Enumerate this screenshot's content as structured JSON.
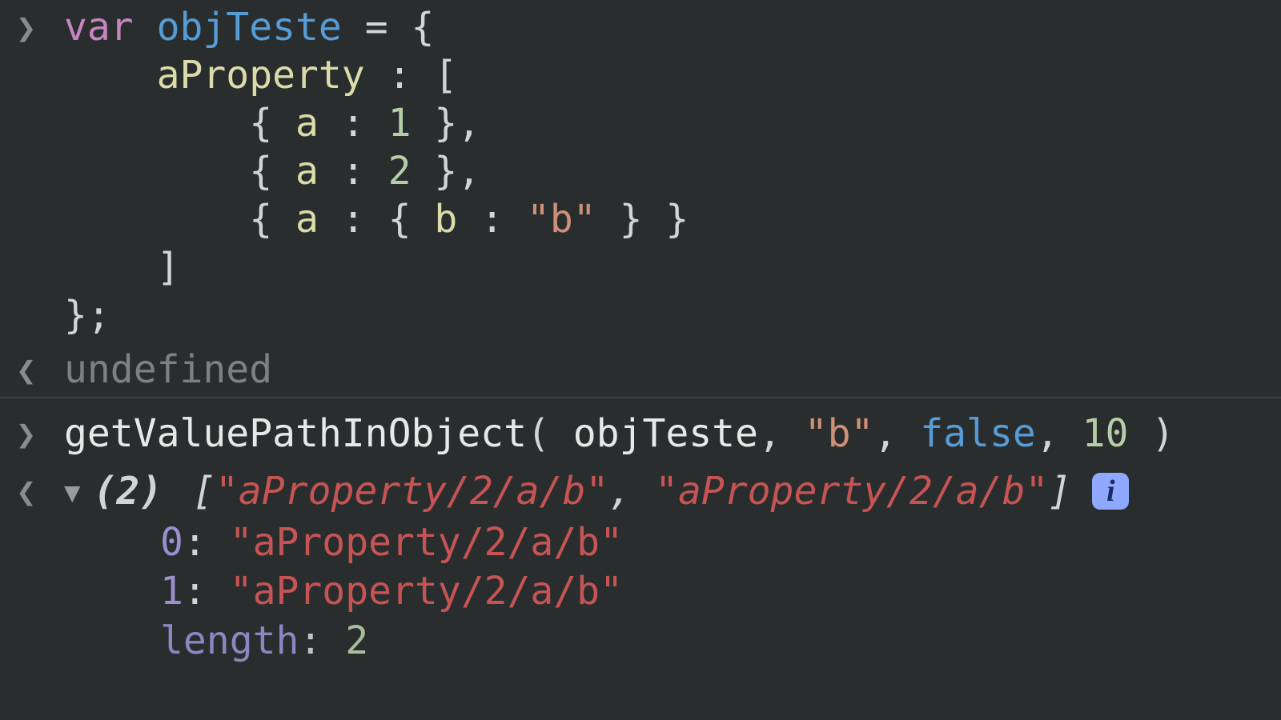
{
  "input1": {
    "tokens": {
      "kw_var": "var",
      "ident": "objTeste",
      "eq": " = ",
      "lbrace": "{",
      "prop": "aProperty",
      "colon": " : ",
      "lbracket": "[",
      "obj1": "{ a : 1 },",
      "obj2": "{ a : 2 },",
      "obj3_open": "{ a : { b : ",
      "obj3_str": "\"b\"",
      "obj3_close": " } }",
      "rbracket": "]",
      "rbrace": "};"
    }
  },
  "result1": "undefined",
  "input2": {
    "fn": "getValuePathInObject",
    "arg_obj": "objTeste",
    "arg_str": "\"b\"",
    "arg_bool": "false",
    "arg_num": "10"
  },
  "result2": {
    "count": "(2)",
    "lbr": " [",
    "item0": "\"aProperty/2/a/b\"",
    "sep": ", ",
    "item1": "\"aProperty/2/a/b\"",
    "rbr": "]",
    "entries": {
      "i0": "0",
      "i1": "1",
      "v0": "\"aProperty/2/a/b\"",
      "v1": "\"aProperty/2/a/b\"",
      "len_label": "length",
      "len_val": "2"
    }
  }
}
